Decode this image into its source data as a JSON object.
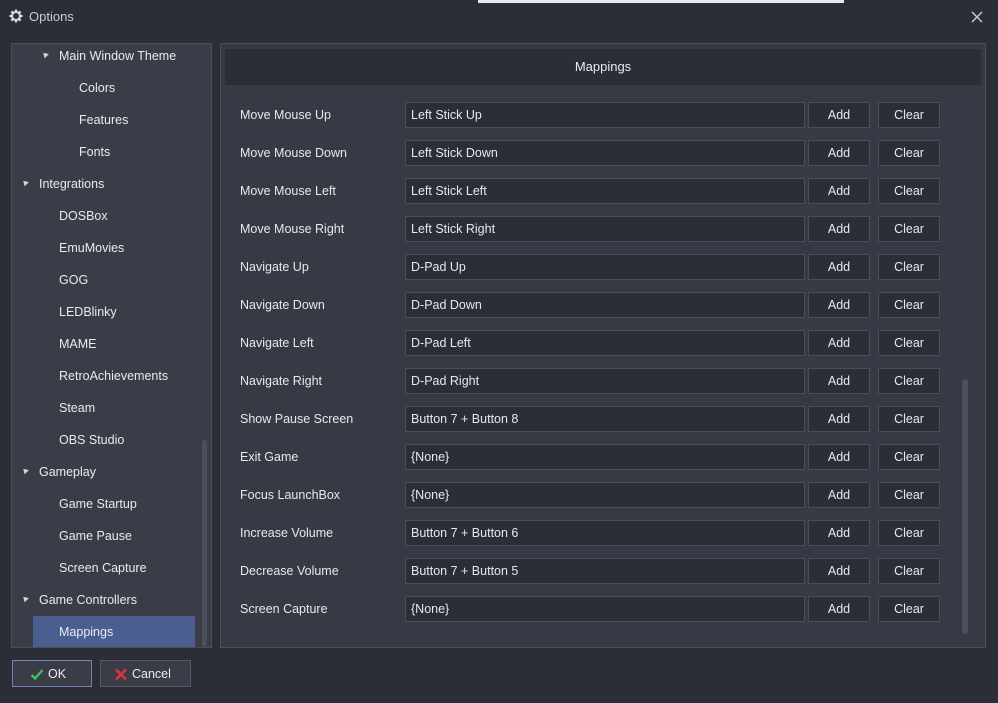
{
  "window": {
    "title": "Options"
  },
  "tree": {
    "items": [
      {
        "label": "Main Window Theme",
        "level": 1,
        "expanded": true
      },
      {
        "label": "Colors",
        "level": 2
      },
      {
        "label": "Features",
        "level": 2
      },
      {
        "label": "Fonts",
        "level": 2
      },
      {
        "label": "Integrations",
        "level": 0,
        "expanded": true
      },
      {
        "label": "DOSBox",
        "level": 1
      },
      {
        "label": "EmuMovies",
        "level": 1
      },
      {
        "label": "GOG",
        "level": 1
      },
      {
        "label": "LEDBlinky",
        "level": 1
      },
      {
        "label": "MAME",
        "level": 1
      },
      {
        "label": "RetroAchievements",
        "level": 1
      },
      {
        "label": "Steam",
        "level": 1
      },
      {
        "label": "OBS Studio",
        "level": 1
      },
      {
        "label": "Gameplay",
        "level": 0,
        "expanded": true
      },
      {
        "label": "Game Startup",
        "level": 1
      },
      {
        "label": "Game Pause",
        "level": 1
      },
      {
        "label": "Screen Capture",
        "level": 1
      },
      {
        "label": "Game Controllers",
        "level": 0,
        "expanded": true
      },
      {
        "label": "Mappings",
        "level": 1,
        "selected": true
      }
    ]
  },
  "main": {
    "header": "Mappings",
    "add_label": "Add",
    "clear_label": "Clear",
    "rows": [
      {
        "label": "Move Mouse Up",
        "value": "Left Stick Up"
      },
      {
        "label": "Move Mouse Down",
        "value": "Left Stick Down"
      },
      {
        "label": "Move Mouse Left",
        "value": "Left Stick Left"
      },
      {
        "label": "Move Mouse Right",
        "value": "Left Stick Right"
      },
      {
        "label": "Navigate Up",
        "value": "D-Pad Up"
      },
      {
        "label": "Navigate Down",
        "value": "D-Pad Down"
      },
      {
        "label": "Navigate Left",
        "value": "D-Pad Left"
      },
      {
        "label": "Navigate Right",
        "value": "D-Pad Right"
      },
      {
        "label": "Show Pause Screen",
        "value": "Button 7 + Button 8"
      },
      {
        "label": "Exit Game",
        "value": "{None}"
      },
      {
        "label": "Focus LaunchBox",
        "value": "{None}"
      },
      {
        "label": "Increase Volume",
        "value": "Button 7 + Button 6"
      },
      {
        "label": "Decrease Volume",
        "value": "Button 7 + Button 5"
      },
      {
        "label": "Screen Capture",
        "value": "{None}"
      }
    ]
  },
  "footer": {
    "ok_label": "OK",
    "cancel_label": "Cancel"
  },
  "colors": {
    "selection": "#4a5f8f",
    "ok_check": "#3fbf5a",
    "cancel_x": "#d9383a"
  },
  "icons": {
    "title": "gear-icon",
    "close": "close-icon",
    "ok": "check-icon",
    "cancel": "x-icon"
  }
}
